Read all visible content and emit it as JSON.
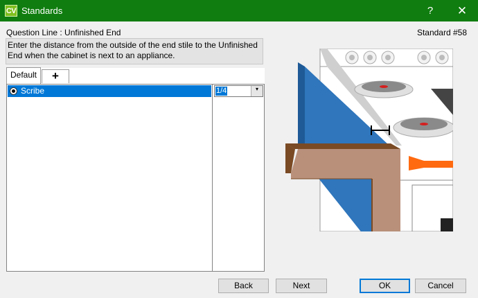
{
  "window": {
    "app_icon_text": "CV",
    "title": "Standards",
    "help_label": "?",
    "close_label": "✕"
  },
  "question": {
    "line_label": "Question Line : Unfinished End",
    "standard_label": "Standard #58",
    "description": "Enter the distance from the outside of the end stile to the Unfinished End when the cabinet is next to an appliance."
  },
  "tabs": [
    {
      "label": "Default",
      "active": true
    },
    {
      "label": "+",
      "active": false
    }
  ],
  "options": [
    {
      "label": "Scribe",
      "selected": true,
      "value": "1/4"
    }
  ],
  "buttons": {
    "back": "Back",
    "next": "Next",
    "ok": "OK",
    "cancel": "Cancel"
  },
  "colors": {
    "titlebar": "#0f7d0f",
    "selection": "#0078d7",
    "panel_blue": "#2f76bc",
    "counter_brown": "#b9907a",
    "burner_red": "#d41f1f",
    "knob_orange": "#ff6a10"
  }
}
